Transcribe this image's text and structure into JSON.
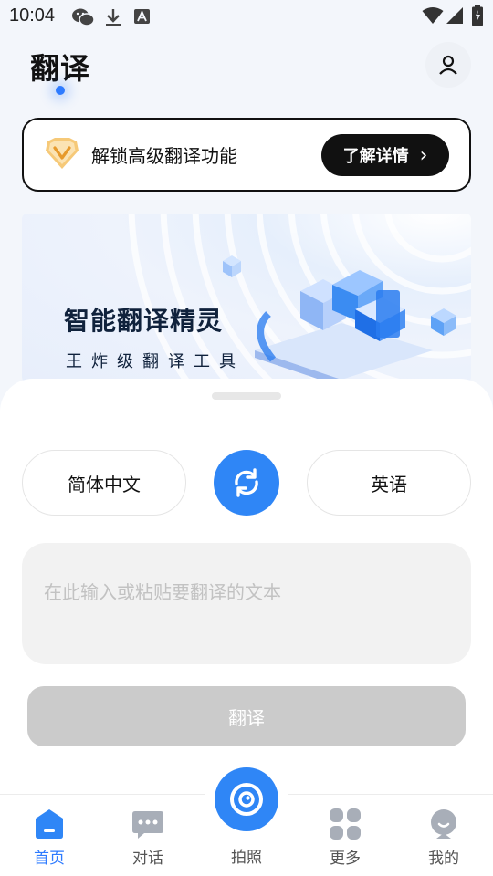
{
  "status_bar": {
    "time": "10:04"
  },
  "header": {
    "title": "翻译"
  },
  "promo": {
    "text": "解锁高级翻译功能",
    "button_label": "了解详情",
    "button_arrow": "›"
  },
  "banner": {
    "title": "智能翻译精灵",
    "subtitle": "王炸级翻译工具"
  },
  "translator": {
    "source_language": "简体中文",
    "target_language": "英语",
    "input_placeholder": "在此输入或粘贴要翻译的文本",
    "input_value": "",
    "translate_label": "翻译"
  },
  "bottom_nav": {
    "items": [
      {
        "label": "首页",
        "icon": "home-icon",
        "active": true
      },
      {
        "label": "对话",
        "icon": "chat-icon",
        "active": false
      },
      {
        "label": "拍照",
        "icon": "camera-icon",
        "active": false
      },
      {
        "label": "更多",
        "icon": "grid-icon",
        "active": false
      },
      {
        "label": "我的",
        "icon": "user-face-icon",
        "active": false
      }
    ]
  },
  "colors": {
    "accent": "#2f86f6",
    "dark": "#111111",
    "disabled": "#cbcbcb",
    "badge": "#f6b24a"
  }
}
